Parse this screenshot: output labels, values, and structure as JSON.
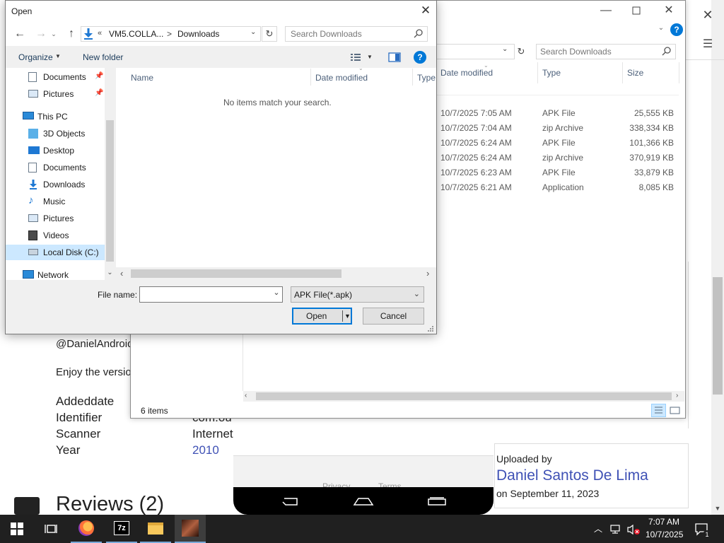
{
  "webpage": {
    "handle": "@DanielAndroidG",
    "enjoy": "Enjoy the version",
    "meta": [
      {
        "label": "Addeddate",
        "value": ""
      },
      {
        "label": "Identifier",
        "value": "com.ou"
      },
      {
        "label": "Scanner",
        "value": "Internet"
      },
      {
        "label": "Year",
        "value": "2010"
      }
    ],
    "reviews": "Reviews (2)",
    "uploaded_by_label": "Uploaded by",
    "uploader": "Daniel Santos De Lima",
    "uploaded_on": "on September 11, 2023",
    "footer_links": [
      "Privacy",
      "Terms"
    ]
  },
  "explorer": {
    "search_placeholder": "Search Downloads",
    "columns": [
      "Date modified",
      "Type",
      "Size"
    ],
    "rows": [
      {
        "date": "10/7/2025 7:05 AM",
        "type": "APK File",
        "size": "25,555 KB"
      },
      {
        "date": "10/7/2025 7:04 AM",
        "type": "zip Archive",
        "size": "338,334 KB"
      },
      {
        "date": "10/7/2025 6:24 AM",
        "type": "APK File",
        "size": "101,366 KB"
      },
      {
        "date": "10/7/2025 6:24 AM",
        "type": "zip Archive",
        "size": "370,919 KB"
      },
      {
        "date": "10/7/2025 6:23 AM",
        "type": "APK File",
        "size": "33,879 KB"
      },
      {
        "date": "10/7/2025 6:21 AM",
        "type": "Application",
        "size": "8,085 KB"
      }
    ],
    "status": "6 items"
  },
  "dialog": {
    "title": "Open",
    "breadcrumb": {
      "prefix": "«",
      "parent": "VM5.COLLA...",
      "separator": ">",
      "current": "Downloads"
    },
    "search_placeholder": "Search Downloads",
    "toolbar": {
      "organize": "Organize",
      "new_folder": "New folder"
    },
    "nav": [
      {
        "label": "Documents",
        "icon": "documents-icon",
        "indent": 1,
        "pinned": true
      },
      {
        "label": "Pictures",
        "icon": "pictures-icon",
        "indent": 1,
        "pinned": true
      },
      {
        "label": "This PC",
        "icon": "pc-icon",
        "indent": 0,
        "pinned": false
      },
      {
        "label": "3D Objects",
        "icon": "3d-objects-icon",
        "indent": 1,
        "pinned": false
      },
      {
        "label": "Desktop",
        "icon": "desktop-icon",
        "indent": 1,
        "pinned": false
      },
      {
        "label": "Documents",
        "icon": "documents-icon",
        "indent": 1,
        "pinned": false
      },
      {
        "label": "Downloads",
        "icon": "downloads-icon",
        "indent": 1,
        "pinned": false
      },
      {
        "label": "Music",
        "icon": "music-icon",
        "indent": 1,
        "pinned": false
      },
      {
        "label": "Pictures",
        "icon": "pictures-icon",
        "indent": 1,
        "pinned": false
      },
      {
        "label": "Videos",
        "icon": "videos-icon",
        "indent": 1,
        "pinned": false
      },
      {
        "label": "Local Disk (C:)",
        "icon": "disk-icon",
        "indent": 1,
        "pinned": false,
        "selected": true
      },
      {
        "label": "Network",
        "icon": "network-icon",
        "indent": 0,
        "pinned": false
      }
    ],
    "columns": [
      "Name",
      "Date modified",
      "Type"
    ],
    "empty_message": "No items match your search.",
    "filename_label": "File name:",
    "filename_value": "",
    "filetype": "APK File(*.apk)",
    "open_label": "Open",
    "cancel_label": "Cancel"
  },
  "taskbar": {
    "time": "7:07 AM",
    "date": "10/7/2025",
    "notification_count": "1"
  },
  "colors": {
    "accent": "#0078d7",
    "link": "#3f51b5",
    "taskbar": "#202020",
    "selected": "#cce8ff"
  }
}
